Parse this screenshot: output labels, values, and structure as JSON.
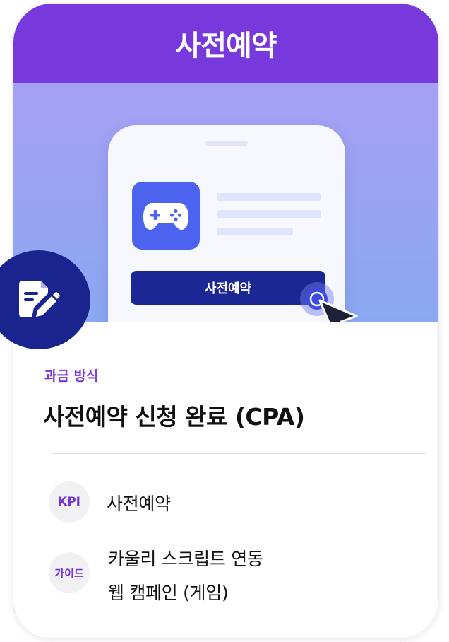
{
  "header": {
    "title": "사전예약"
  },
  "hero": {
    "app_icon": "gamepad-icon",
    "phone_button_label": "사전예약",
    "cursor_icon": "arrow-cursor-icon"
  },
  "badge": {
    "icon": "document-edit-icon"
  },
  "billing": {
    "label": "과금 방식",
    "value": "사전예약 신청 완료 (CPA)"
  },
  "kpi": {
    "tag": "KPI",
    "text": "사전예약"
  },
  "guide": {
    "tag": "가이드",
    "lines": [
      "카울리 스크립트 연동",
      "웹 캠페인 (게임)"
    ]
  },
  "colors": {
    "header": "#7739db",
    "accent_text": "#7a34d9",
    "button": "#1a2794",
    "badge": "#19248f",
    "app_icon": "#4b63ee"
  }
}
